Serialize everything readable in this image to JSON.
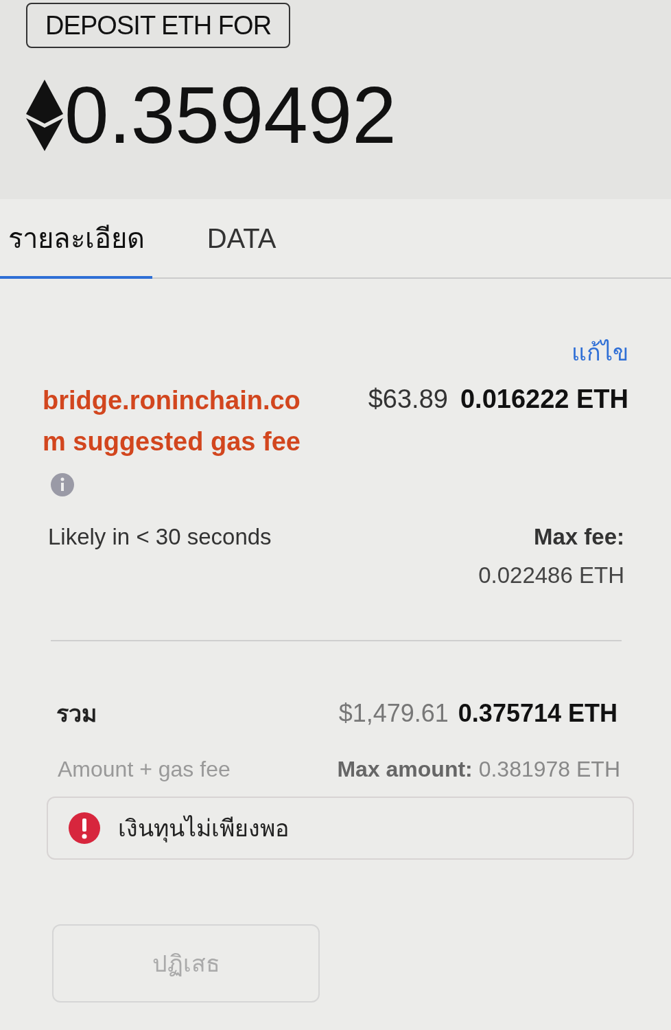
{
  "header": {
    "badge": "DEPOSIT ETH FOR",
    "amount": "0.359492"
  },
  "tabs": [
    {
      "label": "รายละเอียด",
      "selected": true
    },
    {
      "label": "DATA",
      "selected": false
    }
  ],
  "edit_link": "แก้ไข",
  "gas_fee": {
    "label": "bridge.roninchain.com suggested gas fee",
    "fiat": "$63.89",
    "eth": "0.016222 ETH",
    "timing": "Likely in < 30 seconds",
    "max_label": "Max fee:",
    "max_value": "0.022486 ETH"
  },
  "total": {
    "label": "รวม",
    "fiat": "$1,479.61",
    "eth": "0.375714 ETH",
    "sublabel": "Amount + gas fee",
    "max_label": "Max amount:",
    "max_value": "0.381978 ETH"
  },
  "error": {
    "message": "เงินทุนไม่เพียงพอ"
  },
  "buttons": [
    {
      "label": "ปฏิเสธ",
      "disabled": true
    }
  ]
}
